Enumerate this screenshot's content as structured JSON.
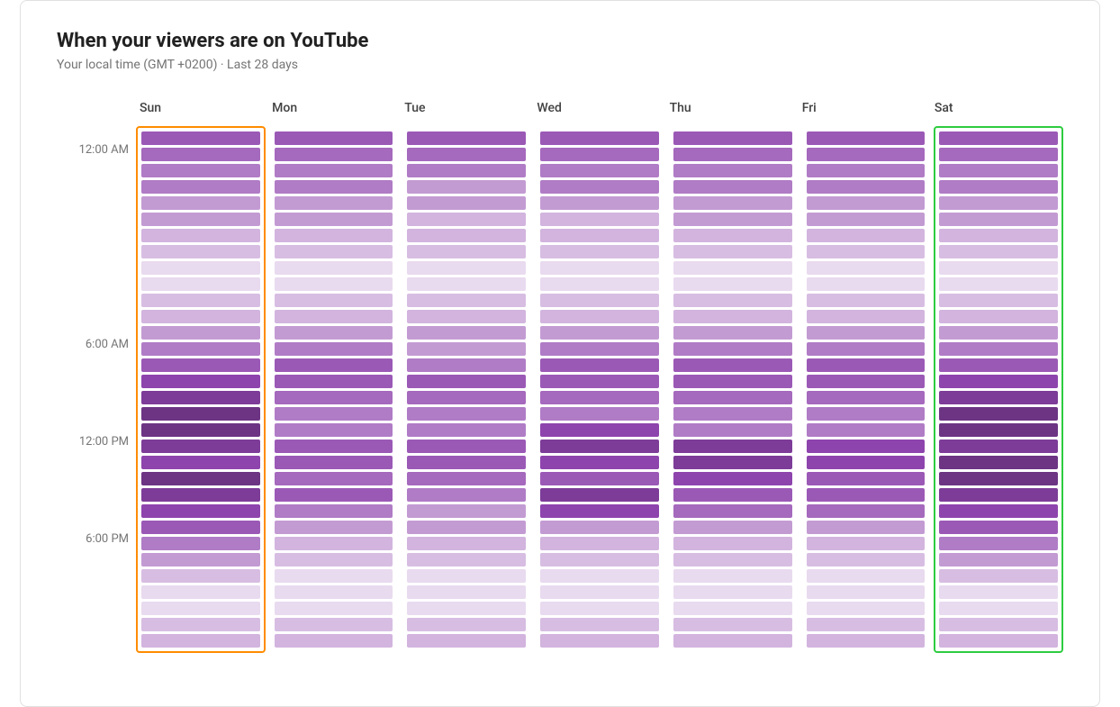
{
  "title": "When your viewers are on YouTube",
  "subtitle": "Your local time (GMT +0200) · Last 28 days",
  "yLabels": [
    {
      "label": "12:00 AM",
      "position": 0
    },
    {
      "label": "6:00 AM",
      "position": 1
    },
    {
      "label": "12:00 PM",
      "position": 2
    },
    {
      "label": "6:00 PM",
      "position": 3
    }
  ],
  "days": [
    {
      "name": "Sun",
      "highlight": "orange",
      "cells": [
        "#9b59b6",
        "#a569bd",
        "#b07cc6",
        "#b07cc6",
        "#c39bd3",
        "#c39bd3",
        "#d2b4de",
        "#d7bde2",
        "#e8daef",
        "#e8daef",
        "#d7bde2",
        "#d2b4de",
        "#c39bd3",
        "#b07cc6",
        "#9b59b6",
        "#8e44ad",
        "#7d3c98",
        "#6c3483",
        "#6c3483",
        "#7d3c98",
        "#8e44ad",
        "#6c3483",
        "#7d3c98",
        "#8e44ad",
        "#9b59b6",
        "#b07cc6",
        "#c39bd3",
        "#d7bde2",
        "#e8daef",
        "#e8daef",
        "#d7bde2",
        "#d2b4de"
      ]
    },
    {
      "name": "Mon",
      "highlight": null,
      "cells": [
        "#9b59b6",
        "#a569bd",
        "#b07cc6",
        "#b07cc6",
        "#c39bd3",
        "#c39bd3",
        "#d2b4de",
        "#d7bde2",
        "#e8daef",
        "#e8daef",
        "#d7bde2",
        "#d2b4de",
        "#c39bd3",
        "#b07cc6",
        "#9b59b6",
        "#9b59b6",
        "#a569bd",
        "#b07cc6",
        "#b07cc6",
        "#9b59b6",
        "#9b59b6",
        "#a569bd",
        "#9b59b6",
        "#b07cc6",
        "#c39bd3",
        "#d2b4de",
        "#d7bde2",
        "#e8daef",
        "#e8daef",
        "#e8daef",
        "#d7bde2",
        "#d2b4de"
      ]
    },
    {
      "name": "Tue",
      "highlight": null,
      "cells": [
        "#9b59b6",
        "#a569bd",
        "#b07cc6",
        "#c39bd3",
        "#c39bd3",
        "#d2b4de",
        "#d2b4de",
        "#d7bde2",
        "#e8daef",
        "#e8daef",
        "#d7bde2",
        "#d2b4de",
        "#c39bd3",
        "#c39bd3",
        "#b07cc6",
        "#9b59b6",
        "#a569bd",
        "#b07cc6",
        "#b07cc6",
        "#9b59b6",
        "#9b59b6",
        "#a569bd",
        "#b07cc6",
        "#c39bd3",
        "#c39bd3",
        "#d2b4de",
        "#d7bde2",
        "#e8daef",
        "#e8daef",
        "#e8daef",
        "#d7bde2",
        "#d2b4de"
      ]
    },
    {
      "name": "Wed",
      "highlight": null,
      "cells": [
        "#9b59b6",
        "#a569bd",
        "#b07cc6",
        "#b07cc6",
        "#c39bd3",
        "#d2b4de",
        "#d2b4de",
        "#d7bde2",
        "#e8daef",
        "#e8daef",
        "#d7bde2",
        "#d2b4de",
        "#c39bd3",
        "#b07cc6",
        "#9b59b6",
        "#9b59b6",
        "#a569bd",
        "#b07cc6",
        "#8e44ad",
        "#7d3c98",
        "#8e44ad",
        "#9b59b6",
        "#7d3c98",
        "#8e44ad",
        "#c39bd3",
        "#d2b4de",
        "#d7bde2",
        "#e8daef",
        "#e8daef",
        "#e8daef",
        "#d7bde2",
        "#d2b4de"
      ]
    },
    {
      "name": "Thu",
      "highlight": null,
      "cells": [
        "#9b59b6",
        "#a569bd",
        "#b07cc6",
        "#b07cc6",
        "#c39bd3",
        "#c39bd3",
        "#d2b4de",
        "#d7bde2",
        "#e8daef",
        "#e8daef",
        "#d7bde2",
        "#d2b4de",
        "#c39bd3",
        "#b07cc6",
        "#9b59b6",
        "#9b59b6",
        "#a569bd",
        "#b07cc6",
        "#b07cc6",
        "#7d3c98",
        "#7d3c98",
        "#8e44ad",
        "#9b59b6",
        "#a569bd",
        "#c39bd3",
        "#d2b4de",
        "#d7bde2",
        "#e8daef",
        "#e8daef",
        "#e8daef",
        "#d7bde2",
        "#d2b4de"
      ]
    },
    {
      "name": "Fri",
      "highlight": null,
      "cells": [
        "#9b59b6",
        "#a569bd",
        "#b07cc6",
        "#b07cc6",
        "#c39bd3",
        "#c39bd3",
        "#d2b4de",
        "#d7bde2",
        "#e8daef",
        "#e8daef",
        "#d7bde2",
        "#d2b4de",
        "#c39bd3",
        "#b07cc6",
        "#9b59b6",
        "#9b59b6",
        "#a569bd",
        "#b07cc6",
        "#b07cc6",
        "#8e44ad",
        "#8e44ad",
        "#9b59b6",
        "#9b59b6",
        "#a569bd",
        "#c39bd3",
        "#d2b4de",
        "#d7bde2",
        "#e8daef",
        "#e8daef",
        "#e8daef",
        "#d7bde2",
        "#d2b4de"
      ]
    },
    {
      "name": "Sat",
      "highlight": "green",
      "cells": [
        "#9b59b6",
        "#a569bd",
        "#b07cc6",
        "#b07cc6",
        "#c39bd3",
        "#c39bd3",
        "#d2b4de",
        "#d7bde2",
        "#e8daef",
        "#e8daef",
        "#d7bde2",
        "#d2b4de",
        "#c39bd3",
        "#b07cc6",
        "#9b59b6",
        "#8e44ad",
        "#7d3c98",
        "#6c3483",
        "#6c3483",
        "#7d3c98",
        "#6c3483",
        "#6c3483",
        "#7d3c98",
        "#8e44ad",
        "#9b59b6",
        "#b07cc6",
        "#c39bd3",
        "#d7bde2",
        "#e8daef",
        "#e8daef",
        "#d7bde2",
        "#d2b4de"
      ]
    }
  ],
  "yPositions": [
    0,
    12,
    18,
    24
  ]
}
